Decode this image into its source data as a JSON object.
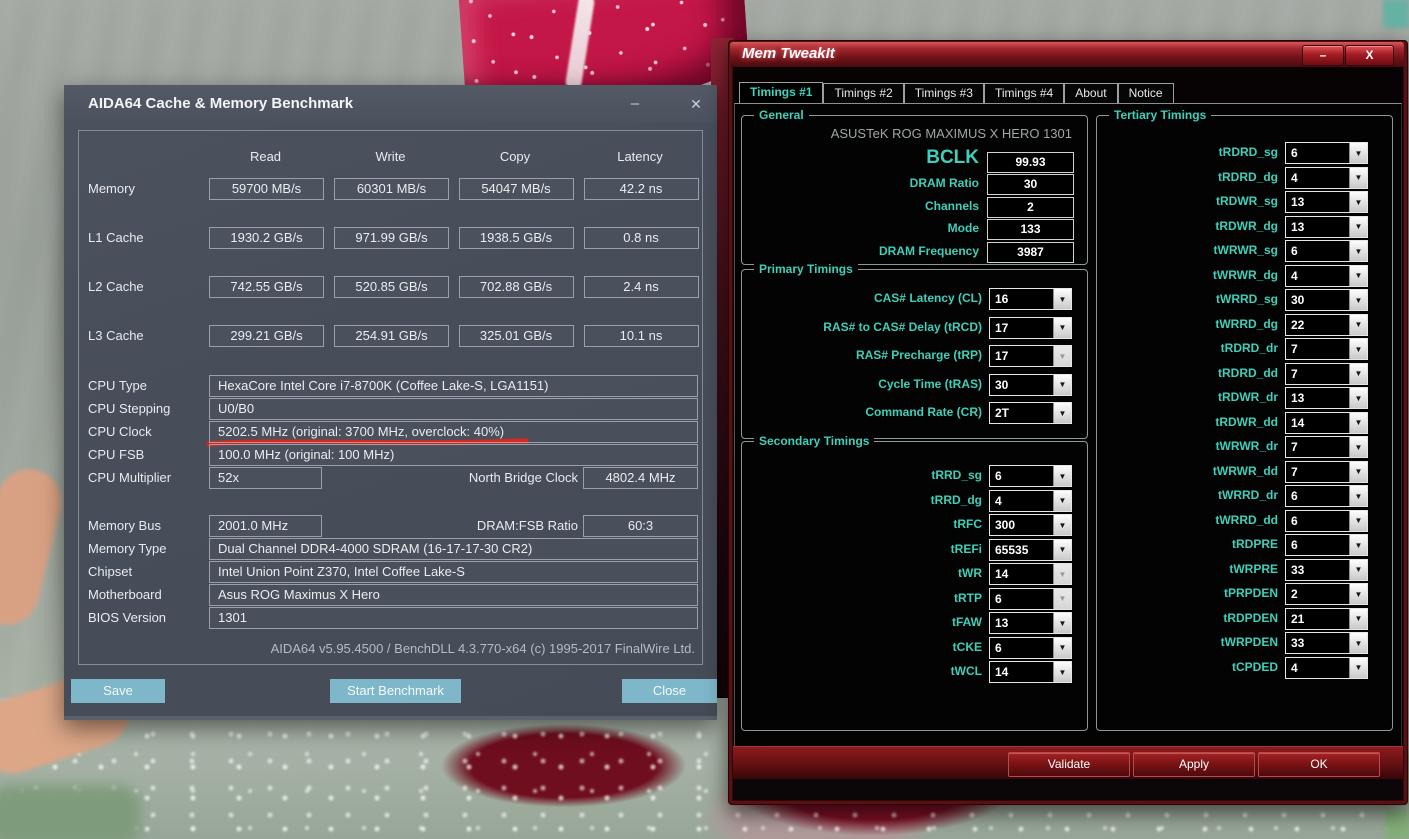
{
  "colors": {
    "aida_button": "#7db7c9",
    "mtk_teal": "#3fcfba",
    "mtk_red": "#8c1a1d",
    "underline_red": "#e02318"
  },
  "aida64": {
    "title": "AIDA64 Cache & Memory Benchmark",
    "window_controls": {
      "minimize": "–",
      "close": "✕"
    },
    "columns": [
      "Read",
      "Write",
      "Copy",
      "Latency"
    ],
    "bench_rows": [
      {
        "label": "Memory",
        "values": [
          "59700 MB/s",
          "60301 MB/s",
          "54047 MB/s",
          "42.2 ns"
        ]
      },
      {
        "label": "L1 Cache",
        "values": [
          "1930.2 GB/s",
          "971.99 GB/s",
          "1938.5 GB/s",
          "0.8 ns"
        ]
      },
      {
        "label": "L2 Cache",
        "values": [
          "742.55 GB/s",
          "520.85 GB/s",
          "702.88 GB/s",
          "2.4 ns"
        ]
      },
      {
        "label": "L3 Cache",
        "values": [
          "299.21 GB/s",
          "254.91 GB/s",
          "325.01 GB/s",
          "10.1 ns"
        ]
      }
    ],
    "info_rows": [
      {
        "label": "CPU Type",
        "value": "HexaCore Intel Core i7-8700K (Coffee Lake-S, LGA1151)"
      },
      {
        "label": "CPU Stepping",
        "value": "U0/B0"
      },
      {
        "label": "CPU Clock",
        "value": "5202.5 MHz (original: 3700 MHz, overclock: 40%)",
        "underline": true
      },
      {
        "label": "CPU FSB",
        "value": "100.0 MHz (original: 100 MHz)"
      }
    ],
    "multiplier_row": {
      "label": "CPU Multiplier",
      "value": "52x",
      "right_label": "North Bridge Clock",
      "right_value": "4802.4 MHz"
    },
    "membus_row": {
      "label": "Memory Bus",
      "value": "2001.0 MHz",
      "right_label": "DRAM:FSB Ratio",
      "right_value": "60:3"
    },
    "info_rows2": [
      {
        "label": "Memory Type",
        "value": "Dual Channel DDR4-4000 SDRAM (16-17-17-30 CR2)"
      },
      {
        "label": "Chipset",
        "value": "Intel Union Point Z370, Intel Coffee Lake-S"
      },
      {
        "label": "Motherboard",
        "value": "Asus ROG Maximus X Hero"
      },
      {
        "label": "BIOS Version",
        "value": "1301"
      }
    ],
    "footer": "AIDA64 v5.95.4500 / BenchDLL 4.3.770-x64 (c) 1995-2017 FinalWire Ltd.",
    "buttons": {
      "save": "Save",
      "start": "Start Benchmark",
      "close": "Close"
    }
  },
  "memtweakit": {
    "title": "Mem TweakIt",
    "window_controls": {
      "minimize": "–",
      "close": "X"
    },
    "tabs": [
      {
        "label": "Timings #1",
        "active": true
      },
      {
        "label": "Timings #2",
        "active": false
      },
      {
        "label": "Timings #3",
        "active": false
      },
      {
        "label": "Timings #4",
        "active": false
      },
      {
        "label": "About",
        "active": false
      },
      {
        "label": "Notice",
        "active": false
      }
    ],
    "general": {
      "title": "General",
      "board": "ASUSTeK ROG MAXIMUS X HERO 1301",
      "fields": [
        {
          "label": "BCLK",
          "value": "99.93",
          "big": true
        },
        {
          "label": "DRAM Ratio",
          "value": "30"
        },
        {
          "label": "Channels",
          "value": "2"
        },
        {
          "label": "Mode",
          "value": "133"
        },
        {
          "label": "DRAM Frequency",
          "value": "3987"
        }
      ]
    },
    "primary": {
      "title": "Primary Timings",
      "fields": [
        {
          "label": "CAS# Latency (CL)",
          "value": "16"
        },
        {
          "label": "RAS# to CAS# Delay (tRCD)",
          "value": "17"
        },
        {
          "label": "RAS# Precharge (tRP)",
          "value": "17",
          "disabled": true
        },
        {
          "label": "Cycle Time (tRAS)",
          "value": "30"
        },
        {
          "label": "Command Rate (CR)",
          "value": "2T"
        }
      ]
    },
    "secondary": {
      "title": "Secondary Timings",
      "fields": [
        {
          "label": "tRRD_sg",
          "value": "6"
        },
        {
          "label": "tRRD_dg",
          "value": "4"
        },
        {
          "label": "tRFC",
          "value": "300"
        },
        {
          "label": "tREFi",
          "value": "65535"
        },
        {
          "label": "tWR",
          "value": "14",
          "disabled": true
        },
        {
          "label": "tRTP",
          "value": "6",
          "disabled": true
        },
        {
          "label": "tFAW",
          "value": "13"
        },
        {
          "label": "tCKE",
          "value": "6"
        },
        {
          "label": "tWCL",
          "value": "14"
        }
      ]
    },
    "tertiary": {
      "title": "Tertiary Timings",
      "fields": [
        {
          "label": "tRDRD_sg",
          "value": "6"
        },
        {
          "label": "tRDRD_dg",
          "value": "4"
        },
        {
          "label": "tRDWR_sg",
          "value": "13"
        },
        {
          "label": "tRDWR_dg",
          "value": "13"
        },
        {
          "label": "tWRWR_sg",
          "value": "6"
        },
        {
          "label": "tWRWR_dg",
          "value": "4"
        },
        {
          "label": "tWRRD_sg",
          "value": "30"
        },
        {
          "label": "tWRRD_dg",
          "value": "22"
        },
        {
          "label": "tRDRD_dr",
          "value": "7"
        },
        {
          "label": "tRDRD_dd",
          "value": "7"
        },
        {
          "label": "tRDWR_dr",
          "value": "13"
        },
        {
          "label": "tRDWR_dd",
          "value": "14"
        },
        {
          "label": "tWRWR_dr",
          "value": "7"
        },
        {
          "label": "tWRWR_dd",
          "value": "7"
        },
        {
          "label": "tWRRD_dr",
          "value": "6"
        },
        {
          "label": "tWRRD_dd",
          "value": "6"
        },
        {
          "label": "tRDPRE",
          "value": "6"
        },
        {
          "label": "tWRPRE",
          "value": "33"
        },
        {
          "label": "tPRPDEN",
          "value": "2"
        },
        {
          "label": "tRDPDEN",
          "value": "21"
        },
        {
          "label": "tWRPDEN",
          "value": "33"
        },
        {
          "label": "tCPDED",
          "value": "4"
        }
      ]
    },
    "buttons": [
      {
        "label": "Validate"
      },
      {
        "label": "Apply"
      },
      {
        "label": "OK"
      }
    ]
  }
}
